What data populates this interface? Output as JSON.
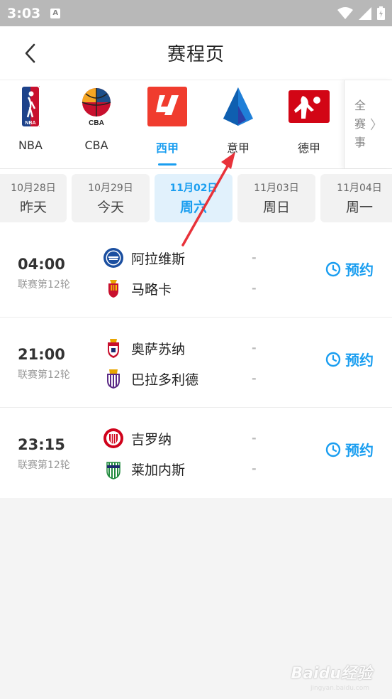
{
  "status_bar": {
    "time": "3:03",
    "notification_icon": "A"
  },
  "header": {
    "title": "赛程页"
  },
  "leagues": [
    {
      "name": "NBA",
      "icon": "nba-logo",
      "active": false
    },
    {
      "name": "CBA",
      "icon": "cba-logo",
      "active": false
    },
    {
      "name": "西甲",
      "icon": "laliga-logo",
      "active": true
    },
    {
      "name": "意甲",
      "icon": "serie-a-logo",
      "active": false
    },
    {
      "name": "德甲",
      "icon": "bundesliga-logo",
      "active": false
    }
  ],
  "all_events": "全赛事",
  "dates": [
    {
      "date": "10月28日",
      "day": "昨天",
      "active": false
    },
    {
      "date": "10月29日",
      "day": "今天",
      "active": false
    },
    {
      "date": "11月02日",
      "day": "周六",
      "active": true
    },
    {
      "date": "11月03日",
      "day": "周日",
      "active": false
    },
    {
      "date": "11月04日",
      "day": "周一",
      "active": false
    }
  ],
  "matches": [
    {
      "time": "04:00",
      "round": "联赛第12轮",
      "home": "阿拉维斯",
      "away": "马略卡",
      "home_score": "-",
      "away_score": "-",
      "action": "预约"
    },
    {
      "time": "21:00",
      "round": "联赛第12轮",
      "home": "奥萨苏纳",
      "away": "巴拉多利德",
      "home_score": "-",
      "away_score": "-",
      "action": "预约"
    },
    {
      "time": "23:15",
      "round": "联赛第12轮",
      "home": "吉罗纳",
      "away": "莱加内斯",
      "home_score": "-",
      "away_score": "-",
      "action": "预约"
    }
  ],
  "watermark": {
    "main": "Baidu经验",
    "sub": "jingyan.baidu.com"
  },
  "colors": {
    "accent": "#1a9ef0",
    "annotation_arrow": "#e8323a"
  }
}
